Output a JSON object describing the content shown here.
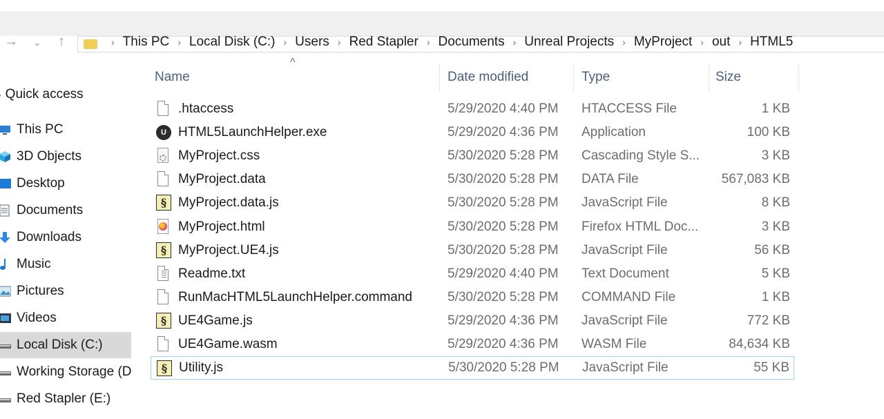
{
  "breadcrumbs": [
    "This PC",
    "Local Disk (C:)",
    "Users",
    "Red Stapler",
    "Documents",
    "Unreal Projects",
    "MyProject",
    "out",
    "HTML5"
  ],
  "nav": {
    "back_icon": "back-arrow-icon",
    "forward_icon": "forward-arrow-icon",
    "up_icon": "up-arrow-icon"
  },
  "sidebar": {
    "items": [
      {
        "label": "Quick access",
        "icon": "star-icon"
      },
      {
        "label": "This PC",
        "icon": "computer-icon"
      },
      {
        "label": "3D Objects",
        "icon": "cube-icon"
      },
      {
        "label": "Desktop",
        "icon": "desktop-icon"
      },
      {
        "label": "Documents",
        "icon": "document-icon"
      },
      {
        "label": "Downloads",
        "icon": "download-icon"
      },
      {
        "label": "Music",
        "icon": "music-icon"
      },
      {
        "label": "Pictures",
        "icon": "picture-icon"
      },
      {
        "label": "Videos",
        "icon": "video-icon"
      },
      {
        "label": "Local Disk (C:)",
        "icon": "drive-icon"
      },
      {
        "label": "Working Storage (D",
        "icon": "drive-icon"
      },
      {
        "label": "Red Stapler (E:)",
        "icon": "drive-icon"
      }
    ],
    "selected_index": 9
  },
  "columns": {
    "name": "Name",
    "date": "Date modified",
    "type": "Type",
    "size": "Size"
  },
  "files": [
    {
      "name": ".htaccess",
      "date": "5/29/2020 4:40 PM",
      "type": "HTACCESS File",
      "size": "1 KB",
      "icon": "blank-file-icon"
    },
    {
      "name": "HTML5LaunchHelper.exe",
      "date": "5/29/2020 4:36 PM",
      "type": "Application",
      "size": "100 KB",
      "icon": "unreal-engine-icon"
    },
    {
      "name": "MyProject.css",
      "date": "5/30/2020 5:28 PM",
      "type": "Cascading Style S...",
      "size": "3 KB",
      "icon": "css-file-icon"
    },
    {
      "name": "MyProject.data",
      "date": "5/30/2020 5:28 PM",
      "type": "DATA File",
      "size": "567,083 KB",
      "icon": "blank-file-icon"
    },
    {
      "name": "MyProject.data.js",
      "date": "5/30/2020 5:28 PM",
      "type": "JavaScript File",
      "size": "8 KB",
      "icon": "javascript-file-icon"
    },
    {
      "name": "MyProject.html",
      "date": "5/30/2020 5:28 PM",
      "type": "Firefox HTML Doc...",
      "size": "3 KB",
      "icon": "firefox-html-icon"
    },
    {
      "name": "MyProject.UE4.js",
      "date": "5/30/2020 5:28 PM",
      "type": "JavaScript File",
      "size": "56 KB",
      "icon": "javascript-file-icon"
    },
    {
      "name": "Readme.txt",
      "date": "5/29/2020 4:40 PM",
      "type": "Text Document",
      "size": "5 KB",
      "icon": "text-file-icon"
    },
    {
      "name": "RunMacHTML5LaunchHelper.command",
      "date": "5/30/2020 5:28 PM",
      "type": "COMMAND File",
      "size": "1 KB",
      "icon": "blank-file-icon"
    },
    {
      "name": "UE4Game.js",
      "date": "5/29/2020 4:36 PM",
      "type": "JavaScript File",
      "size": "772 KB",
      "icon": "javascript-file-icon"
    },
    {
      "name": "UE4Game.wasm",
      "date": "5/29/2020 4:36 PM",
      "type": "WASM File",
      "size": "84,634 KB",
      "icon": "blank-file-icon"
    },
    {
      "name": "Utility.js",
      "date": "5/30/2020 5:28 PM",
      "type": "JavaScript File",
      "size": "55 KB",
      "icon": "javascript-file-icon"
    }
  ],
  "focused_index": 11
}
